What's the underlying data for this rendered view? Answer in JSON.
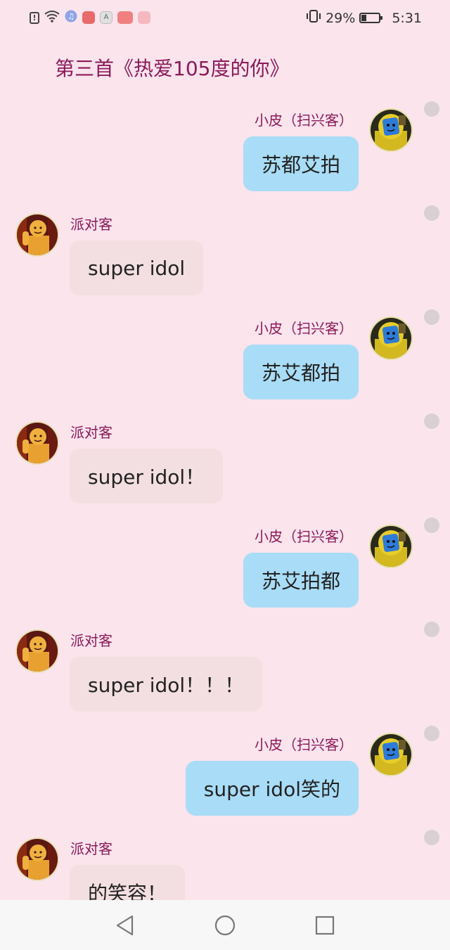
{
  "status_bar": {
    "battery_percent": "29%",
    "battery_level": 0.29,
    "time": "5:31",
    "left_icons": [
      "alert-icon",
      "wifi-icon",
      "music-icon",
      "app-icon-cat",
      "app-icon-a",
      "app-icon-red",
      "app-icon-pink"
    ]
  },
  "chat": {
    "title": "第三首《热爱105度的你》",
    "messages": [
      {
        "side": "right",
        "sender": "小皮（扫兴客）",
        "text": "苏都艾拍"
      },
      {
        "side": "left",
        "sender": "派对客",
        "text": "super idol"
      },
      {
        "side": "right",
        "sender": "小皮（扫兴客）",
        "text": "苏艾都拍"
      },
      {
        "side": "left",
        "sender": "派对客",
        "text": "super idol！"
      },
      {
        "side": "right",
        "sender": "小皮（扫兴客）",
        "text": "苏艾拍都"
      },
      {
        "side": "left",
        "sender": "派对客",
        "text": "super idol！！！"
      },
      {
        "side": "right",
        "sender": "小皮（扫兴客）",
        "text": "super idol笑的"
      },
      {
        "side": "left",
        "sender": "派对客",
        "text": "的笑容！"
      }
    ]
  },
  "navigation": {
    "buttons": [
      "back-icon",
      "home-icon",
      "recents-icon"
    ]
  }
}
